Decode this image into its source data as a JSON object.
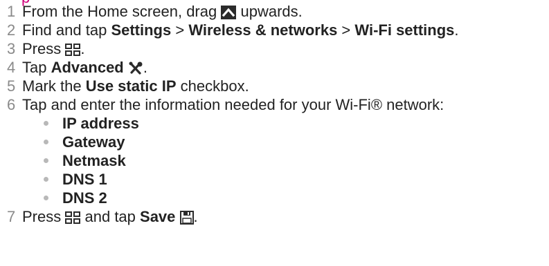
{
  "steps": [
    {
      "num": "1",
      "before": "From the Home screen, drag",
      "icon": "up-arrow-icon",
      "after": "upwards."
    },
    {
      "num": "2",
      "t1": "Find and tap ",
      "b1": "Settings",
      "sep1": " > ",
      "b2": "Wireless & networks",
      "sep2": " > ",
      "b3": "Wi-Fi settings",
      "end": "."
    },
    {
      "num": "3",
      "before": "Press",
      "icon": "menu-icon",
      "after": "."
    },
    {
      "num": "4",
      "before": "Tap ",
      "bold": "Advanced",
      "icon": "tools-icon",
      "after": "."
    },
    {
      "num": "5",
      "before": "Mark the ",
      "bold": "Use static IP",
      "after": " checkbox."
    },
    {
      "num": "6",
      "text": "Tap and enter the information needed for your Wi-Fi® network:"
    },
    {
      "num": "7",
      "before": "Press",
      "icon": "menu-icon",
      "mid": "and tap ",
      "bold": "Save",
      "icon2": "save-icon",
      "after": "."
    }
  ],
  "sub_items": [
    "IP address",
    "Gateway",
    "Netmask",
    "DNS 1",
    "DNS 2"
  ],
  "colors": {
    "heading": "#d0007a",
    "number": "#8a8a8a",
    "bullet": "#b8b8b8",
    "icon_dark": "#2b2b2b"
  }
}
